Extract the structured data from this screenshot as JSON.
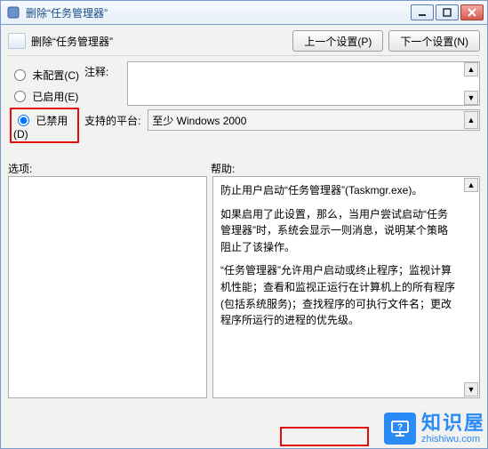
{
  "titlebar": {
    "title": "删除“任务管理器”"
  },
  "header": {
    "policy_title": "删除“任务管理器”",
    "prev_btn": "上一个设置(P)",
    "next_btn": "下一个设置(N)"
  },
  "radios": {
    "not_configured": "未配置(C)",
    "enabled": "已启用(E)",
    "disabled": "已禁用(D)"
  },
  "labels": {
    "comment": "注释:",
    "platform": "支持的平台:",
    "options": "选项:",
    "help": "帮助:"
  },
  "platform": {
    "text": "至少 Windows 2000"
  },
  "help": {
    "p1": "防止用户启动“任务管理器”(Taskmgr.exe)。",
    "p2": "如果启用了此设置，那么，当用户尝试启动“任务管理器”时，系统会显示一则消息，说明某个策略阻止了该操作。",
    "p3": "“任务管理器”允许用户启动或终止程序；监视计算机性能；查看和监视正运行在计算机上的所有程序(包括系统服务)；查找程序的可执行文件名；更改程序所运行的进程的优先级。"
  },
  "watermark": {
    "brand": "知识屋",
    "url": "zhishiwu.com"
  }
}
